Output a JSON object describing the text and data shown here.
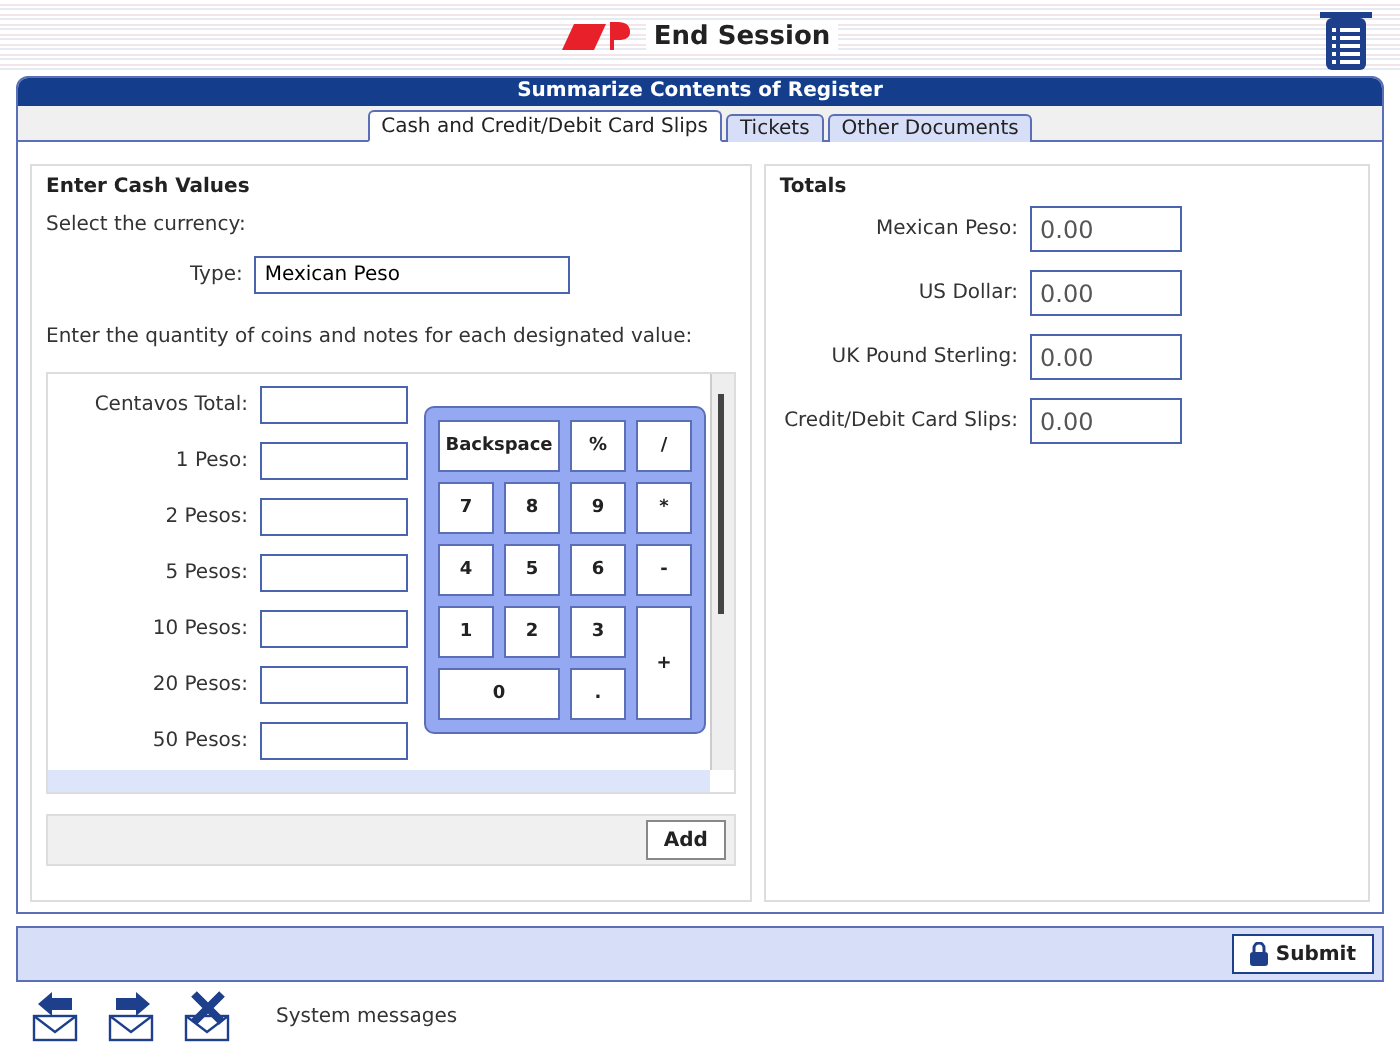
{
  "header": {
    "title": "End Session"
  },
  "panel": {
    "title": "Summarize Contents of Register"
  },
  "tabs": [
    {
      "label": "Cash and Credit/Debit Card Slips",
      "selected": true
    },
    {
      "label": "Tickets",
      "selected": false
    },
    {
      "label": "Other Documents",
      "selected": false
    }
  ],
  "cash": {
    "heading": "Enter Cash Values",
    "currency_prompt": "Select the currency:",
    "type_label": "Type:",
    "type_value": "Mexican Peso",
    "quantity_prompt": "Enter the quantity of coins and notes for each designated value:",
    "denominations": [
      {
        "label": "Centavos Total:"
      },
      {
        "label": "1 Peso:"
      },
      {
        "label": "2 Pesos:"
      },
      {
        "label": "5 Pesos:"
      },
      {
        "label": "10 Pesos:"
      },
      {
        "label": "20 Pesos:"
      },
      {
        "label": "50 Pesos:"
      }
    ],
    "keypad": [
      {
        "label": "Backspace",
        "kind": "wide"
      },
      {
        "label": "%",
        "kind": "normal"
      },
      {
        "label": "/",
        "kind": "normal"
      },
      {
        "label": "7",
        "kind": "normal"
      },
      {
        "label": "8",
        "kind": "normal"
      },
      {
        "label": "9",
        "kind": "normal"
      },
      {
        "label": "*",
        "kind": "normal"
      },
      {
        "label": "4",
        "kind": "normal"
      },
      {
        "label": "5",
        "kind": "normal"
      },
      {
        "label": "6",
        "kind": "normal"
      },
      {
        "label": "-",
        "kind": "normal"
      },
      {
        "label": "1",
        "kind": "normal"
      },
      {
        "label": "2",
        "kind": "normal"
      },
      {
        "label": "3",
        "kind": "normal"
      },
      {
        "label": "+",
        "kind": "tall"
      },
      {
        "label": "0",
        "kind": "wide"
      },
      {
        "label": ".",
        "kind": "normal"
      }
    ],
    "add_button": "Add"
  },
  "totals": {
    "heading": "Totals",
    "rows": [
      {
        "label": "Mexican Peso:",
        "value": "0.00"
      },
      {
        "label": "US Dollar:",
        "value": "0.00"
      },
      {
        "label": "UK Pound Sterling:",
        "value": "0.00"
      },
      {
        "label": "Credit/Debit Card Slips:",
        "value": "0.00"
      }
    ]
  },
  "submit_button": "Submit",
  "footer": {
    "message": "System messages"
  }
}
